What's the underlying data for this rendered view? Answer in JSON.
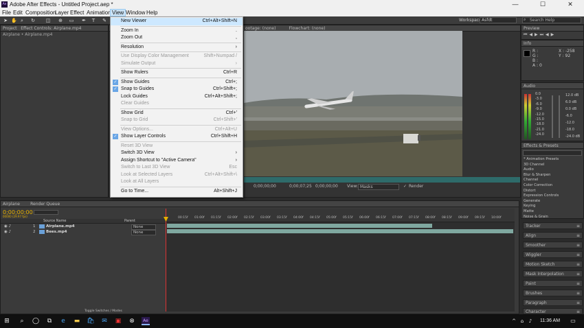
{
  "window": {
    "title": "Adobe After Effects - Untitled Project.aep *",
    "logo": "Ae",
    "minimize": "—",
    "maximize": "☐",
    "close": "✕"
  },
  "menubar": [
    "File",
    "Edit",
    "Composition",
    "Layer",
    "Effect",
    "Animation",
    "View",
    "Window",
    "Help"
  ],
  "active_menu": "View",
  "toolbar": {
    "workspace_label": "Workspace:",
    "workspace_value": "Asfdt",
    "search_placeholder": "Search Help"
  },
  "view_menu": [
    {
      "label": "New Viewer",
      "shortcut": "Ctrl+Alt+Shift+N",
      "highlighted": true
    },
    {
      "sep": true
    },
    {
      "label": "Zoom In",
      "shortcut": "."
    },
    {
      "label": "Zoom Out",
      "shortcut": ","
    },
    {
      "sep": true
    },
    {
      "label": "Resolution",
      "shortcut": "",
      "submenu": true
    },
    {
      "sep": true
    },
    {
      "label": "Use Display Color Management",
      "shortcut": "Shift+Numpad /",
      "disabled": true
    },
    {
      "label": "Simulate Output",
      "shortcut": "",
      "disabled": true,
      "submenu": true
    },
    {
      "sep": true
    },
    {
      "label": "Show Rulers",
      "shortcut": "Ctrl+R"
    },
    {
      "sep": true
    },
    {
      "label": "Show Guides",
      "shortcut": "Ctrl+;",
      "checked": true
    },
    {
      "label": "Snap to Guides",
      "shortcut": "Ctrl+Shift+;",
      "checked": true
    },
    {
      "label": "Lock Guides",
      "shortcut": "Ctrl+Alt+Shift+;"
    },
    {
      "label": "Clear Guides",
      "shortcut": "",
      "disabled": true
    },
    {
      "sep": true
    },
    {
      "label": "Show Grid",
      "shortcut": "Ctrl+'"
    },
    {
      "label": "Snap to Grid",
      "shortcut": "Ctrl+Shift+'",
      "disabled": true
    },
    {
      "sep": true
    },
    {
      "label": "View Options...",
      "shortcut": "Ctrl+Alt+U",
      "disabled": true
    },
    {
      "label": "Show Layer Controls",
      "shortcut": "Ctrl+Shift+H",
      "checked": true
    },
    {
      "sep": true
    },
    {
      "label": "Reset 3D View",
      "shortcut": "",
      "disabled": true
    },
    {
      "label": "Switch 3D View",
      "shortcut": "",
      "submenu": true
    },
    {
      "label": "Assign Shortcut to \"Active Camera\"",
      "shortcut": "",
      "submenu": true
    },
    {
      "label": "Switch to Last 3D View",
      "shortcut": "Esc",
      "disabled": true
    },
    {
      "label": "Look at Selected Layers",
      "shortcut": "Ctrl+Alt+Shift+\\",
      "disabled": true
    },
    {
      "label": "Look at All Layers",
      "shortcut": "",
      "disabled": true
    },
    {
      "sep": true
    },
    {
      "label": "Go to Time...",
      "shortcut": "Alt+Shift+J"
    }
  ],
  "project_panel": {
    "tab": "Project",
    "tab2": "Effect Controls: Airplane.mp4",
    "subtitle": "Airplane • Airplane.mp4"
  },
  "viewer": {
    "tab1": "ootage: (none)",
    "tab2": "Flowchart: (none)",
    "timecode1": "0;00;00;00",
    "timecode2": "0;00;07;25",
    "timecode3": "0;00;00;00",
    "view_label": "View:",
    "view_value": "Masks",
    "render_label": "Render"
  },
  "info_panel": {
    "title": "Info",
    "r": "R :",
    "g": "G :",
    "b": "B :",
    "a": "A : 0",
    "x": "X : -258",
    "y": "Y : 92"
  },
  "preview_panel": {
    "title": "Preview"
  },
  "audio_panel": {
    "title": "Audio",
    "db_left": [
      "0.0",
      "-6.0",
      "-12.0",
      "-18.0",
      "-24.0"
    ],
    "db_scale": [
      "0.0",
      "-3.0",
      "-6.0",
      "-9.0",
      "-12.0",
      "-15.0",
      "-18.0",
      "-21.0",
      "-24.0"
    ],
    "db_right": [
      "12.0 dB",
      "6.0 dB",
      "0.0 dB",
      "-6.0",
      "-12.0",
      "-18.0",
      "-24.0 dB"
    ]
  },
  "effects_panel": {
    "title": "Effects & Presets",
    "items": [
      "* Animation Presets",
      "3D Channel",
      "Audio",
      "Blur & Sharpen",
      "Channel",
      "Color Correction",
      "Distort",
      "Expression Controls",
      "Generate",
      "Keying",
      "Matte",
      "Noise & Grain"
    ]
  },
  "side_panels": [
    "Tracker",
    "Align",
    "Smoother",
    "Wiggler",
    "Motion Sketch",
    "Mask Interpolation",
    "Paint",
    "Brushes",
    "Paragraph",
    "Character"
  ],
  "timeline": {
    "tab1": "Airplane",
    "tab2": "Render Queue",
    "timecode": "0;00;00;00",
    "fps": "00000 (29.97 fps)",
    "cols": {
      "source": "Source Name",
      "parent": "Parent"
    },
    "layers": [
      {
        "num": "1",
        "name": "Airplane.mp4",
        "parent": "None"
      },
      {
        "num": "2",
        "name": "Bees.mp4",
        "parent": "None"
      }
    ],
    "ruler": [
      "00:15f",
      "01:00f",
      "01:15f",
      "02:00f",
      "02:15f",
      "03:00f",
      "03:15f",
      "04:00f",
      "04:15f",
      "05:00f",
      "05:15f",
      "06:00f",
      "06:15f",
      "07:00f",
      "07:15f",
      "08:00f",
      "08:15f",
      "09:00f",
      "09:15f",
      "10:00f"
    ],
    "toggle": "Toggle Switches / Modes"
  },
  "taskbar": {
    "time": "11:36 AM"
  }
}
